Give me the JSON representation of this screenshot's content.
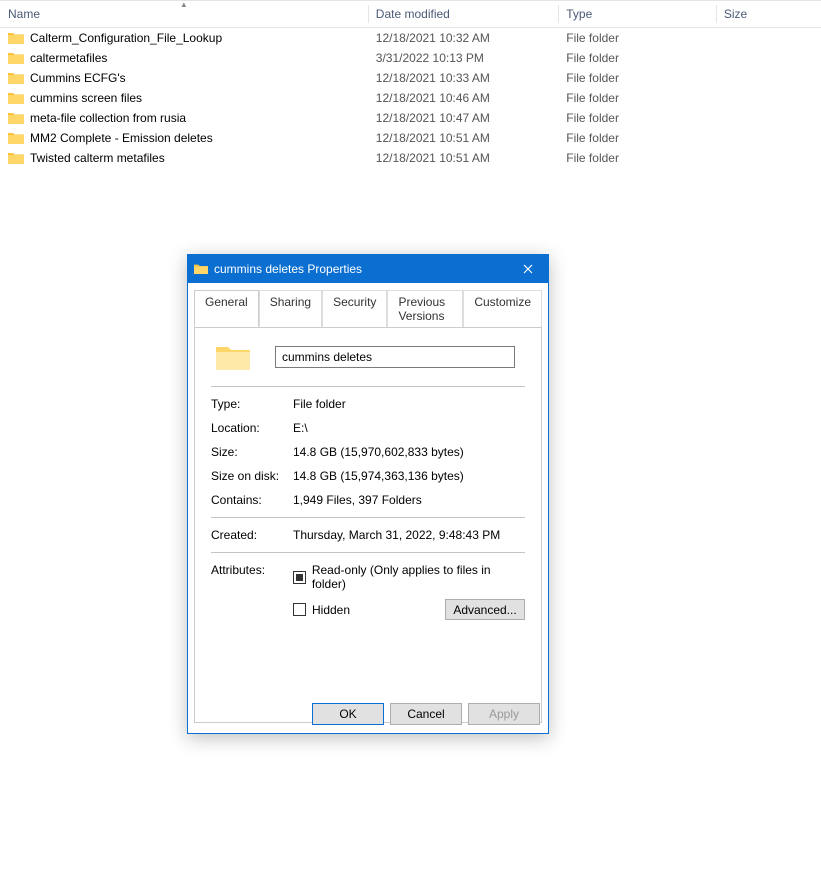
{
  "columns": {
    "name": "Name",
    "date": "Date modified",
    "type": "Type",
    "size": "Size"
  },
  "files": [
    {
      "name": "Calterm_Configuration_File_Lookup",
      "date": "12/18/2021 10:32 AM",
      "type": "File folder"
    },
    {
      "name": "caltermetafiles",
      "date": "3/31/2022 10:13 PM",
      "type": "File folder"
    },
    {
      "name": "Cummins ECFG's",
      "date": "12/18/2021 10:33 AM",
      "type": "File folder"
    },
    {
      "name": "cummins screen files",
      "date": "12/18/2021 10:46 AM",
      "type": "File folder"
    },
    {
      "name": "meta-file collection from rusia",
      "date": "12/18/2021 10:47 AM",
      "type": "File folder"
    },
    {
      "name": "MM2 Complete - Emission deletes",
      "date": "12/18/2021 10:51 AM",
      "type": "File folder"
    },
    {
      "name": "Twisted calterm metafiles",
      "date": "12/18/2021 10:51 AM",
      "type": "File folder"
    }
  ],
  "dialog": {
    "title": "cummins deletes Properties",
    "tabs": {
      "general": "General",
      "sharing": "Sharing",
      "security": "Security",
      "previous": "Previous Versions",
      "customize": "Customize"
    },
    "name_value": "cummins deletes",
    "labels": {
      "type": "Type:",
      "location": "Location:",
      "size": "Size:",
      "sizeondisk": "Size on disk:",
      "contains": "Contains:",
      "created": "Created:",
      "attributes": "Attributes:",
      "readonly": "Read-only (Only applies to files in folder)",
      "hidden": "Hidden",
      "advanced": "Advanced...",
      "ok": "OK",
      "cancel": "Cancel",
      "apply": "Apply"
    },
    "values": {
      "type": "File folder",
      "location": "E:\\",
      "size": "14.8 GB (15,970,602,833 bytes)",
      "sizeondisk": "14.8 GB (15,974,363,136 bytes)",
      "contains": "1,949 Files, 397 Folders",
      "created": "Thursday, March 31, 2022, 9:48:43 PM"
    }
  }
}
